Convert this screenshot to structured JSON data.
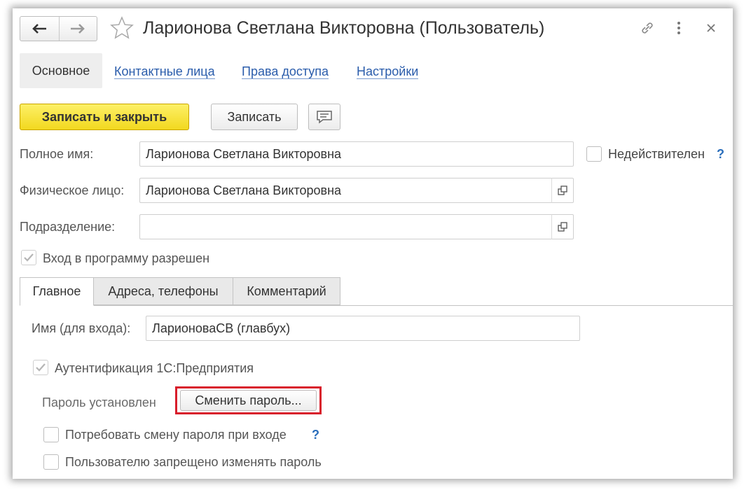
{
  "header": {
    "title": "Ларионова Светлана Викторовна (Пользователь)"
  },
  "sections": {
    "active": "Основное",
    "links": [
      "Контактные лица",
      "Права доступа",
      "Настройки"
    ]
  },
  "toolbar": {
    "save_close_label": "Записать и закрыть",
    "save_label": "Записать"
  },
  "form": {
    "full_name": {
      "label": "Полное имя:",
      "value": "Ларионова Светлана Викторовна"
    },
    "inactive": {
      "label": "Недействителен",
      "help": "?",
      "checked": false
    },
    "person": {
      "label": "Физическое лицо:",
      "value": "Ларионова Светлана Викторовна"
    },
    "department": {
      "label": "Подразделение:",
      "value": ""
    },
    "login_allowed": {
      "label": "Вход в программу разрешен",
      "checked": true
    }
  },
  "tabs": [
    "Главное",
    "Адреса, телефоны",
    "Комментарий"
  ],
  "main_tab": {
    "login_name": {
      "label": "Имя (для входа):",
      "value": "ЛарионоваСВ (главбух)"
    },
    "auth_1c": {
      "label": "Аутентификация 1С:Предприятия",
      "checked": true
    },
    "password_status": "Пароль установлен",
    "change_password_label": "Сменить пароль...",
    "require_change": {
      "label": "Потребовать смену пароля при входе",
      "help": "?",
      "checked": false
    },
    "forbid_change": {
      "label": "Пользователю запрещено изменять пароль",
      "checked": false
    }
  },
  "colors": {
    "accent_yellow": "#f2d81f",
    "link_blue": "#2a5cab",
    "highlight_red": "#d81d2b"
  }
}
